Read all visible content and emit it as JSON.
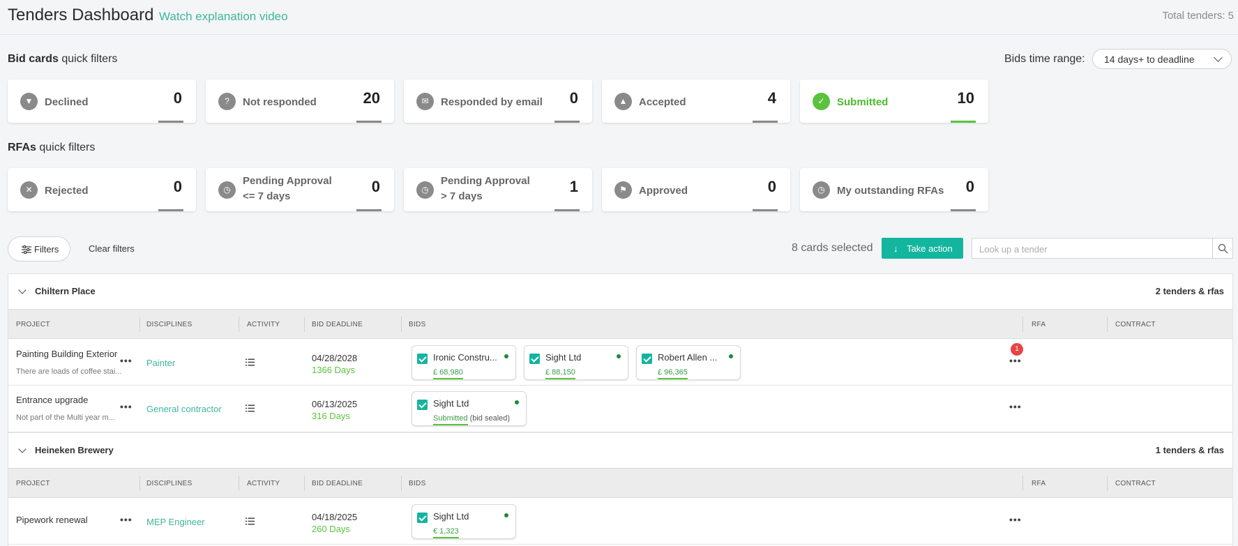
{
  "header": {
    "title": "Tenders Dashboard",
    "video_link": "Watch explanation video",
    "total": "Total tenders: 5"
  },
  "bid_filters": {
    "label_bold": "Bid cards",
    "label_rest": " quick filters",
    "range_label": "Bids time range:",
    "range_value": "14 days+ to deadline",
    "cards": [
      {
        "label": "Declined",
        "count": "0",
        "icon": "thumbs-down-icon"
      },
      {
        "label": "Not responded",
        "count": "20",
        "icon": "question-icon"
      },
      {
        "label": "Responded by email",
        "count": "0",
        "icon": "envelope-icon"
      },
      {
        "label": "Accepted",
        "count": "4",
        "icon": "thumbs-up-icon"
      },
      {
        "label": "Submitted",
        "count": "10",
        "icon": "check-circle-icon"
      }
    ]
  },
  "rfa_filters": {
    "label_bold": "RFAs",
    "label_rest": " quick filters",
    "cards": [
      {
        "label": "Rejected",
        "count": "0",
        "icon": "x-circle-icon"
      },
      {
        "label_line1": "Pending Approval",
        "label_line2": "<= 7 days",
        "count": "0",
        "icon": "clock-icon"
      },
      {
        "label_line1": "Pending Approval",
        "label_line2": "> 7 days",
        "count": "1",
        "icon": "clock-icon"
      },
      {
        "label": "Approved",
        "count": "0",
        "icon": "flag-icon"
      },
      {
        "label": "My outstanding RFAs",
        "count": "0",
        "icon": "clock-icon"
      }
    ]
  },
  "toolbar": {
    "filters": "Filters",
    "clear": "Clear filters",
    "selected": "8 cards selected",
    "action": "Take action",
    "search_placeholder": "Look up a tender"
  },
  "columns": {
    "project": "PROJECT",
    "disciplines": "DISCIPLINES",
    "activity": "ACTIVITY",
    "deadline": "BID DEADLINE",
    "bids": "BIDS",
    "rfa": "RFA",
    "contract": "CONTRACT"
  },
  "groups": [
    {
      "name": "Chiltern Place",
      "count": "2 tenders & rfas",
      "rows": [
        {
          "project": "Painting Building Exterior",
          "desc": "There are loads of coffee stai...",
          "discipline": "Painter",
          "deadline": "04/28/2028",
          "days": "1366 Days",
          "rfa_badge": "1",
          "bids": [
            {
              "name": "Ironic Constru...",
              "value": "£ 68,980"
            },
            {
              "name": "Sight Ltd",
              "value": "£ 88,150"
            },
            {
              "name": "Robert Allen ...",
              "value": "£ 96,365"
            }
          ]
        },
        {
          "project": "Entrance upgrade",
          "desc": "Not part of the Multi year m...",
          "discipline": "General contractor",
          "deadline": "06/13/2025",
          "days": "316 Days",
          "bids": [
            {
              "name": "Sight Ltd",
              "value": "Submitted",
              "extra": " (bid sealed)"
            }
          ]
        }
      ]
    },
    {
      "name": "Heineken Brewery",
      "count": "1 tenders & rfas",
      "rows": [
        {
          "project": "Pipework renewal",
          "discipline": "MEP Engineer",
          "deadline": "04/18/2025",
          "days": "260 Days",
          "bids": [
            {
              "name": "Sight Ltd",
              "value": "€ 1,323"
            }
          ]
        }
      ]
    }
  ],
  "colors": {
    "accent": "#13b59e",
    "green": "#5ac33d",
    "link": "#3fb59c",
    "badge": "#e64545"
  }
}
